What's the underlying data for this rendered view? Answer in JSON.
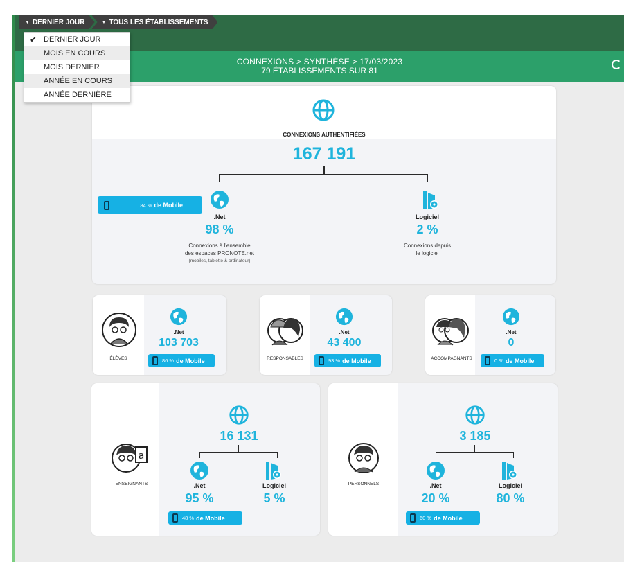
{
  "breadcrumbs": [
    "DERNIER JOUR",
    "TOUS LES ÉTABLISSEMENTS"
  ],
  "dropdown": {
    "items": [
      "DERNIER JOUR",
      "MOIS EN COURS",
      "MOIS DERNIER",
      "ANNÉE EN COURS",
      "ANNÉE DERNIÈRE"
    ],
    "selected": "DERNIER JOUR"
  },
  "header": {
    "title": "CONNEXIONS > SYNTHÈSE > 17/03/2023",
    "subtitle": "79 ÉTABLISSEMENTS SUR 81"
  },
  "summary": {
    "label": "CONNEXIONS AUTHENTIFIÉES",
    "total": "167 191",
    "net": {
      "name": ".Net",
      "pct": "98 %",
      "desc1": "Connexions à l'ensemble",
      "desc2": "des espaces PRONOTE.net",
      "desc3": "(mobiles, tablette & ordinateur)"
    },
    "logiciel": {
      "name": "Logiciel",
      "pct": "2 %",
      "desc1": "Connexions depuis",
      "desc2": "le logiciel"
    },
    "mobile": {
      "pct": "84 %",
      "label": "de Mobile"
    }
  },
  "groups": [
    {
      "label": "ÉLÈVES",
      "net": ".Net",
      "value": "103 703",
      "mobile_pct": "86 %",
      "mobile_label": "de Mobile"
    },
    {
      "label": "RESPONSABLES",
      "net": ".Net",
      "value": "43 400",
      "mobile_pct": "93 %",
      "mobile_label": "de Mobile"
    },
    {
      "label": "ACCOMPAGNANTS",
      "net": ".Net",
      "value": "0",
      "mobile_pct": "0 %",
      "mobile_label": "de Mobile"
    }
  ],
  "staff": [
    {
      "label": "ENSEIGNANTS",
      "total": "16 131",
      "net": ".Net",
      "net_pct": "95 %",
      "logiciel": "Logiciel",
      "logiciel_pct": "5 %",
      "mobile_pct": "48 %",
      "mobile_label": "de Mobile"
    },
    {
      "label": "PERSONNELS",
      "total": "3 185",
      "net": ".Net",
      "net_pct": "20 %",
      "logiciel": "Logiciel",
      "logiciel_pct": "80 %",
      "mobile_pct": "60 %",
      "mobile_label": "de Mobile"
    }
  ],
  "colors": {
    "accent": "#1fb4dc",
    "header_green": "#2ca06a",
    "crumb_dark": "#3f3f3f"
  },
  "icons": {
    "globe": "globe-icon",
    "earth": "earth-icon",
    "software": "software-icon",
    "phone": "phone-icon",
    "refresh": "refresh-icon",
    "check": "check-icon"
  }
}
